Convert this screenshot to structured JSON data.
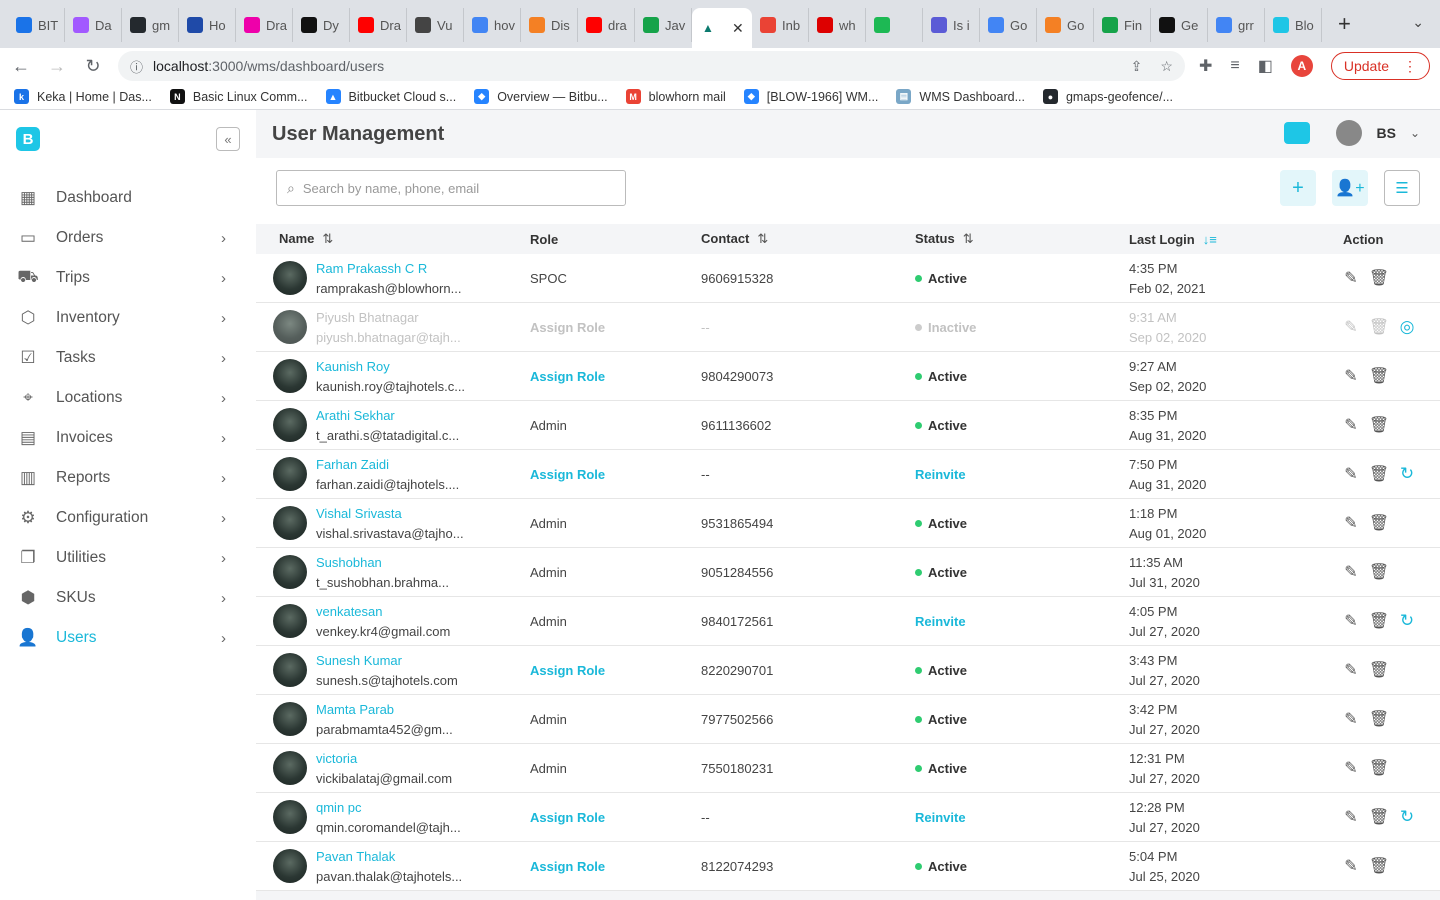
{
  "browser": {
    "tabs": [
      {
        "label": "BIT",
        "color": "#1a73e8"
      },
      {
        "label": "Da",
        "color": "#a259ff"
      },
      {
        "label": "gm",
        "color": "#24292e"
      },
      {
        "label": "Ho",
        "color": "#1f4aa8"
      },
      {
        "label": "Dra",
        "color": "#e0a"
      },
      {
        "label": "Dy",
        "color": "#111"
      },
      {
        "label": "Dra",
        "color": "#ff0000"
      },
      {
        "label": "Vu",
        "color": "#444"
      },
      {
        "label": "hov",
        "color": "#4285f4"
      },
      {
        "label": "Dis",
        "color": "#f48024"
      },
      {
        "label": "dra",
        "color": "#ff0000"
      },
      {
        "label": "Jav",
        "color": "#16a34a"
      }
    ],
    "active_tab_label": "▲",
    "tabs_right": [
      {
        "label": "Inb",
        "color": "#ea4335"
      },
      {
        "label": "wh",
        "color": "#d00"
      },
      {
        "label": "",
        "color": "#1db954"
      },
      {
        "label": "Is i",
        "color": "#5b5bd6"
      },
      {
        "label": "Go",
        "color": "#4285f4"
      },
      {
        "label": "Go",
        "color": "#f48024"
      },
      {
        "label": "Fin",
        "color": "#16a34a"
      },
      {
        "label": "Ge",
        "color": "#111"
      },
      {
        "label": "grr",
        "color": "#4285f4"
      },
      {
        "label": "Blo",
        "color": "#1ec6e6"
      }
    ],
    "url_host": "localhost",
    "url_path": ":3000/wms/dashboard/users",
    "profile_initial": "A",
    "update_label": "Update",
    "bookmarks": [
      {
        "label": "Keka | Home | Das...",
        "color": "#1a73e8",
        "glyph": "k"
      },
      {
        "label": "Basic Linux Comm...",
        "color": "#111",
        "glyph": "N"
      },
      {
        "label": "Bitbucket Cloud s...",
        "color": "#2684ff",
        "glyph": "▲"
      },
      {
        "label": "Overview — Bitbu...",
        "color": "#2684ff",
        "glyph": "◆"
      },
      {
        "label": "blowhorn mail",
        "color": "#ea4335",
        "glyph": "M"
      },
      {
        "label": "[BLOW-1966] WM...",
        "color": "#2684ff",
        "glyph": "◆"
      },
      {
        "label": "WMS Dashboard...",
        "color": "#7aa7c7",
        "glyph": "▤"
      },
      {
        "label": "gmaps-geofence/...",
        "color": "#24292e",
        "glyph": "●"
      }
    ]
  },
  "app": {
    "logo": "B",
    "page_title": "User Management",
    "user_initials": "BS",
    "accent": "#1ab8d9",
    "nav": [
      {
        "label": "Dashboard",
        "icon": "dashboard-icon",
        "glyph": "▦",
        "chevron": false
      },
      {
        "label": "Orders",
        "icon": "orders-icon",
        "glyph": "▭",
        "chevron": true
      },
      {
        "label": "Trips",
        "icon": "truck-icon",
        "glyph": "⛟",
        "chevron": true
      },
      {
        "label": "Inventory",
        "icon": "inventory-icon",
        "glyph": "⬡",
        "chevron": true
      },
      {
        "label": "Tasks",
        "icon": "tasks-icon",
        "glyph": "☑",
        "chevron": true
      },
      {
        "label": "Locations",
        "icon": "location-icon",
        "glyph": "⌖",
        "chevron": true
      },
      {
        "label": "Invoices",
        "icon": "invoice-icon",
        "glyph": "▤",
        "chevron": true
      },
      {
        "label": "Reports",
        "icon": "reports-icon",
        "glyph": "▥",
        "chevron": true
      },
      {
        "label": "Configuration",
        "icon": "gear-icon",
        "glyph": "⚙",
        "chevron": true
      },
      {
        "label": "Utilities",
        "icon": "utilities-icon",
        "glyph": "❐",
        "chevron": true
      },
      {
        "label": "SKUs",
        "icon": "sku-icon",
        "glyph": "⬢",
        "chevron": true
      },
      {
        "label": "Users",
        "icon": "users-icon",
        "glyph": "👤",
        "chevron": true,
        "active": true
      }
    ],
    "search_placeholder": "Search by name, phone, email",
    "search_value": "",
    "columns": {
      "name": "Name",
      "role": "Role",
      "contact": "Contact",
      "status": "Status",
      "last_login": "Last Login",
      "action": "Action"
    },
    "users": [
      {
        "name": "Ram Prakassh C R",
        "email": "ramprakash@blowhorn...",
        "role": "SPOC",
        "role_assign": false,
        "contact": "9606915328",
        "status": "Active",
        "status_type": "active",
        "time": "4:35 PM",
        "date": "Feb 02, 2021",
        "extra_action": ""
      },
      {
        "name": "Piyush Bhatnagar",
        "email": "piyush.bhatnagar@tajh...",
        "role": "Assign Role",
        "role_assign": true,
        "contact": "--",
        "status": "Inactive",
        "status_type": "inactive",
        "time": "9:31 AM",
        "date": "Sep 02, 2020",
        "extra_action": "activate-icon",
        "inactive": true
      },
      {
        "name": "Kaunish Roy",
        "email": "kaunish.roy@tajhotels.c...",
        "role": "Assign Role",
        "role_assign": true,
        "contact": "9804290073",
        "status": "Active",
        "status_type": "active",
        "time": "9:27 AM",
        "date": "Sep 02, 2020",
        "extra_action": ""
      },
      {
        "name": "Arathi Sekhar",
        "email": "t_arathi.s@tatadigital.c...",
        "role": "Admin",
        "role_assign": false,
        "contact": "9611136602",
        "status": "Active",
        "status_type": "active",
        "time": "8:35 PM",
        "date": "Aug 31, 2020",
        "extra_action": ""
      },
      {
        "name": "Farhan Zaidi",
        "email": "farhan.zaidi@tajhotels....",
        "role": "Assign Role",
        "role_assign": true,
        "contact": "--",
        "status": "Reinvite",
        "status_type": "reinvite",
        "time": "7:50 PM",
        "date": "Aug 31, 2020",
        "extra_action": "reinvite-icon"
      },
      {
        "name": "Vishal Srivasta",
        "email": "vishal.srivastava@tajho...",
        "role": "Admin",
        "role_assign": false,
        "contact": "9531865494",
        "status": "Active",
        "status_type": "active",
        "time": "1:18 PM",
        "date": "Aug 01, 2020",
        "extra_action": ""
      },
      {
        "name": "Sushobhan",
        "email": "t_sushobhan.brahma...",
        "role": "Admin",
        "role_assign": false,
        "contact": "9051284556",
        "status": "Active",
        "status_type": "active",
        "time": "11:35 AM",
        "date": "Jul 31, 2020",
        "extra_action": ""
      },
      {
        "name": "venkatesan",
        "email": "venkey.kr4@gmail.com",
        "role": "Admin",
        "role_assign": false,
        "contact": "9840172561",
        "status": "Reinvite",
        "status_type": "reinvite",
        "time": "4:05 PM",
        "date": "Jul 27, 2020",
        "extra_action": "reinvite-icon"
      },
      {
        "name": "Sunesh Kumar",
        "email": "sunesh.s@tajhotels.com",
        "role": "Assign Role",
        "role_assign": true,
        "contact": "8220290701",
        "status": "Active",
        "status_type": "active",
        "time": "3:43 PM",
        "date": "Jul 27, 2020",
        "extra_action": ""
      },
      {
        "name": "Mamta Parab",
        "email": "parabmamta452@gm...",
        "role": "Admin",
        "role_assign": false,
        "contact": "7977502566",
        "status": "Active",
        "status_type": "active",
        "time": "3:42 PM",
        "date": "Jul 27, 2020",
        "extra_action": ""
      },
      {
        "name": "victoria",
        "email": "vickibalataj@gmail.com",
        "role": "Admin",
        "role_assign": false,
        "contact": "7550180231",
        "status": "Active",
        "status_type": "active",
        "time": "12:31 PM",
        "date": "Jul 27, 2020",
        "extra_action": ""
      },
      {
        "name": "qmin pc",
        "email": "qmin.coromandel@tajh...",
        "role": "Assign Role",
        "role_assign": true,
        "contact": "--",
        "status": "Reinvite",
        "status_type": "reinvite",
        "time": "12:28 PM",
        "date": "Jul 27, 2020",
        "extra_action": "reinvite-icon"
      },
      {
        "name": "Pavan Thalak",
        "email": "pavan.thalak@tajhotels...",
        "role": "Assign Role",
        "role_assign": true,
        "contact": "8122074293",
        "status": "Active",
        "status_type": "active",
        "time": "5:04 PM",
        "date": "Jul 25, 2020",
        "extra_action": ""
      }
    ]
  }
}
